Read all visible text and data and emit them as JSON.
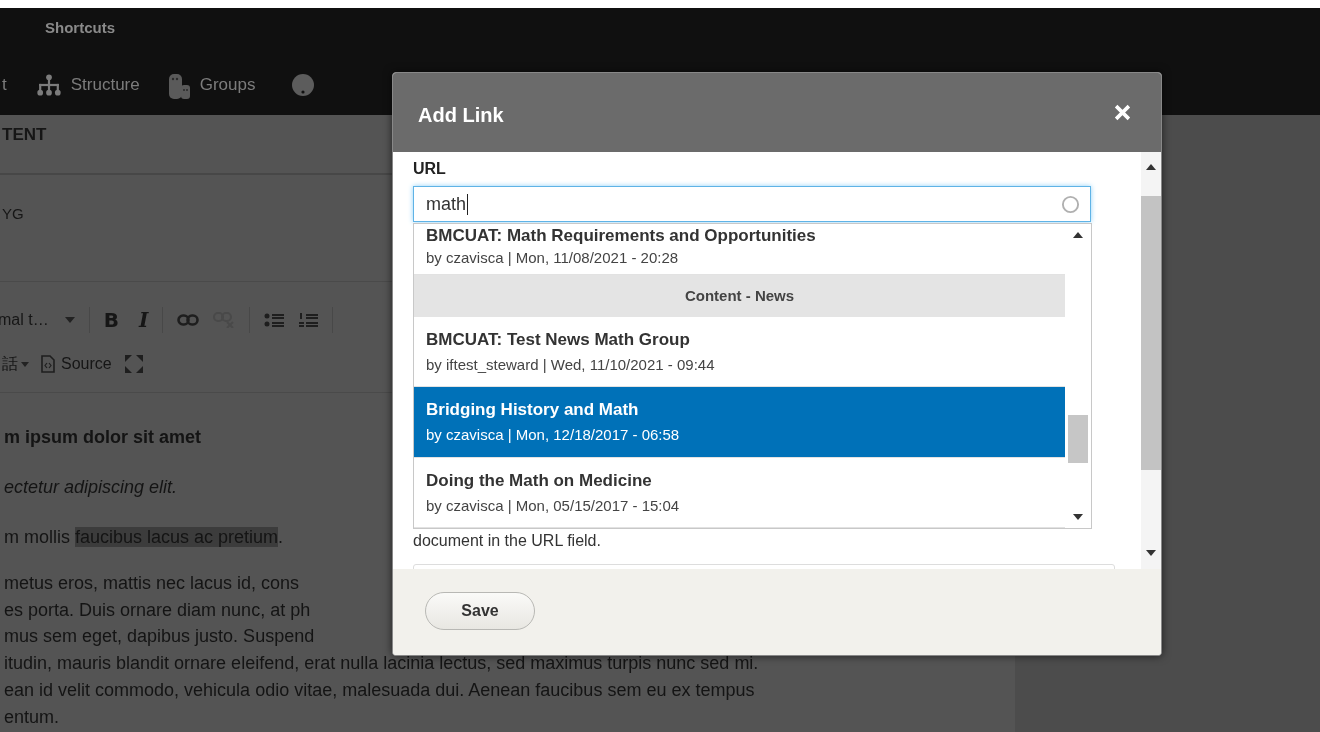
{
  "toolbar": {
    "title": "Shortcuts",
    "nav": [
      {
        "label": "t"
      },
      {
        "label": "Structure"
      },
      {
        "label": "Groups"
      }
    ]
  },
  "editor": {
    "section_title": "TENT",
    "field_label": "YG",
    "format_select": "mal t…",
    "bold_button": "B",
    "italic_button": "I",
    "language_button": "話",
    "source_button": "Source",
    "paragraphs": [
      {
        "kind": "heading",
        "segments": [
          {
            "text": "m ipsum dolor sit amet",
            "highlighted": false
          }
        ]
      },
      {
        "kind": "italic",
        "segments": [
          {
            "text": "ectetur adipiscing elit.",
            "highlighted": false
          }
        ]
      },
      {
        "kind": "plain",
        "segments": [
          {
            "text": "m mollis ",
            "highlighted": false
          },
          {
            "text": "faucibus lacus ac pretium",
            "highlighted": true
          },
          {
            "text": ".",
            "highlighted": false
          }
        ]
      },
      {
        "kind": "lines",
        "lines": [
          "metus eros, mattis nec lacus id, cons",
          "es porta. Duis ornare diam nunc, at ph",
          "mus sem eget, dapibus justo. Suspend",
          "itudin, mauris blandit ornare eleifend, erat nulla lacinia lectus, sed maximus turpis nunc sed mi.",
          "ean id velit commodo, vehicula odio vitae, malesuada dui. Aenean faucibus sem eu ex tempus",
          "entum."
        ]
      }
    ]
  },
  "dialog": {
    "title": "Add Link",
    "url_label": "URL",
    "url_value": "math",
    "help_text": "document in the URL field.",
    "save_button": "Save",
    "results": [
      {
        "kind": "result",
        "title": "BMCUAT: Math Requirements and Opportunities",
        "meta": "by czavisca | Mon, 11/08/2021 - 20:28",
        "selected": false
      },
      {
        "kind": "group",
        "title": "Content - News"
      },
      {
        "kind": "result",
        "title": "BMCUAT: Test News Math Group",
        "meta": "by iftest_steward | Wed, 11/10/2021 - 09:44",
        "selected": false
      },
      {
        "kind": "result",
        "title": "Bridging History and Math",
        "meta": "by czavisca | Mon, 12/18/2017 - 06:58",
        "selected": true
      },
      {
        "kind": "result",
        "title": "Doing the Math on Medicine",
        "meta": "by czavisca | Mon, 05/15/2017 - 15:04",
        "selected": false
      }
    ]
  }
}
